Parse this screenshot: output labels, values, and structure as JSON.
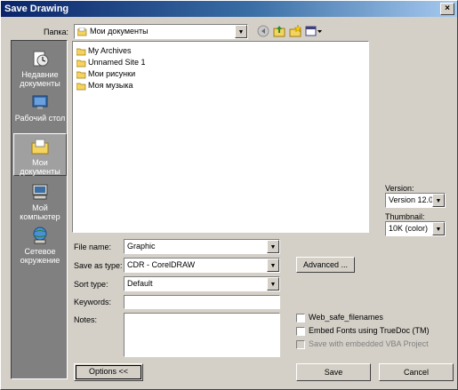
{
  "window": {
    "title": "Save Drawing",
    "close_glyph": "×"
  },
  "folder": {
    "label": "Папка:",
    "value": "Мои документы"
  },
  "places": [
    {
      "label": "Недавние документы",
      "icon": "recent-documents-icon"
    },
    {
      "label": "Рабочий стол",
      "icon": "desktop-icon"
    },
    {
      "label": "Мои документы",
      "icon": "my-documents-icon",
      "selected": true
    },
    {
      "label": "Мой компьютер",
      "icon": "my-computer-icon"
    },
    {
      "label": "Сетевое окружение",
      "icon": "network-places-icon"
    }
  ],
  "files": [
    {
      "name": "My Archives",
      "icon": "folder-icon"
    },
    {
      "name": "Unnamed Site 1",
      "icon": "folder-icon"
    },
    {
      "name": "Мои рисунки",
      "icon": "folder-icon"
    },
    {
      "name": "Моя музыка",
      "icon": "folder-icon"
    }
  ],
  "form": {
    "file_name_label": "File name:",
    "file_name_value": "Graphic",
    "save_as_type_label": "Save as type:",
    "save_as_type_value": "CDR - CorelDRAW",
    "sort_type_label": "Sort type:",
    "sort_type_value": "Default",
    "keywords_label": "Keywords:",
    "keywords_value": "",
    "notes_label": "Notes:",
    "notes_value": ""
  },
  "version": {
    "label": "Version:",
    "value": "Version 12.0"
  },
  "thumbnail": {
    "label": "Thumbnail:",
    "value": "10K (color)"
  },
  "buttons": {
    "advanced": "Advanced ...",
    "options": "Options <<",
    "save": "Save",
    "cancel": "Cancel"
  },
  "checkboxes": [
    {
      "label": "Web_safe_filenames",
      "checked": false,
      "enabled": true
    },
    {
      "label": "Embed Fonts using TrueDoc (TM)",
      "checked": false,
      "enabled": true
    },
    {
      "label": "Save with embedded VBA Project",
      "checked": false,
      "enabled": false
    }
  ]
}
